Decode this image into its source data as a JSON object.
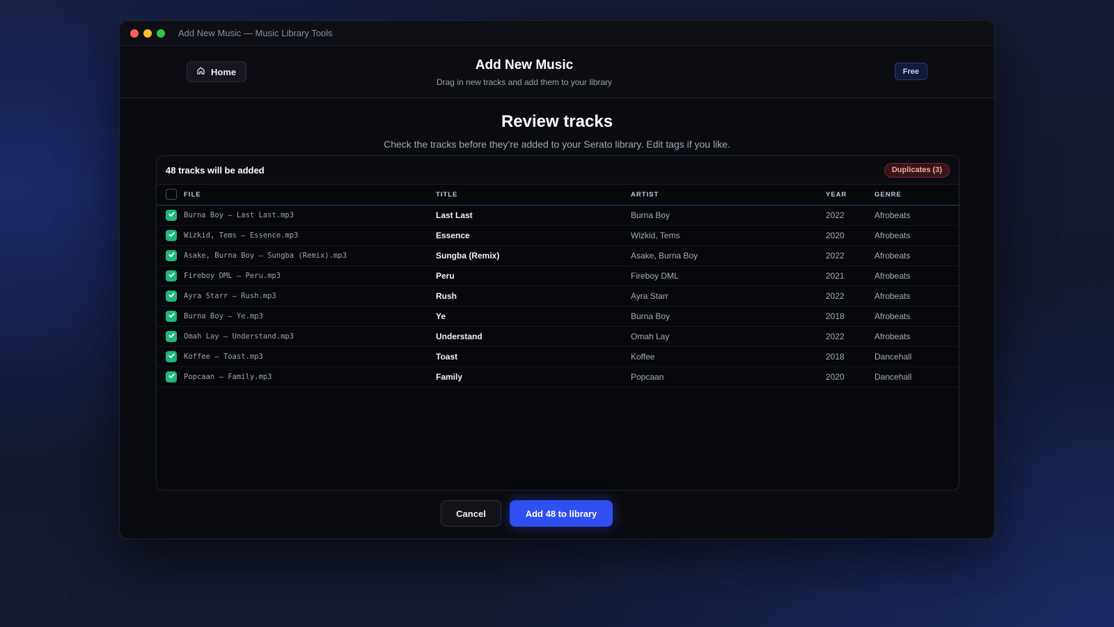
{
  "window": {
    "title": "Add New Music — Music Library Tools"
  },
  "header": {
    "home_label": "Home",
    "title": "Add New Music",
    "subtitle": "Drag in new tracks and add them to your library",
    "plan_badge": "Free"
  },
  "review": {
    "title": "Review tracks",
    "subtitle": "Check the tracks before they’re added to your Serato library. Edit tags if you like."
  },
  "panel": {
    "count_label": "48 tracks will be added",
    "duplicates_label": "Duplicates (3)"
  },
  "table": {
    "select_all_checked": false,
    "columns": [
      "FILE",
      "TITLE",
      "ARTIST",
      "YEAR",
      "GENRE"
    ],
    "rows": [
      {
        "checked": true,
        "file": "Burna Boy – Last Last.mp3",
        "title": "Last Last",
        "artist": "Burna Boy",
        "year": "2022",
        "genre": "Afrobeats"
      },
      {
        "checked": true,
        "file": "Wizkid, Tems – Essence.mp3",
        "title": "Essence",
        "artist": "Wizkid, Tems",
        "year": "2020",
        "genre": "Afrobeats"
      },
      {
        "checked": true,
        "file": "Asake, Burna Boy – Sungba (Remix).mp3",
        "title": "Sungba (Remix)",
        "artist": "Asake, Burna Boy",
        "year": "2022",
        "genre": "Afrobeats"
      },
      {
        "checked": true,
        "file": "Fireboy DML – Peru.mp3",
        "title": "Peru",
        "artist": "Fireboy DML",
        "year": "2021",
        "genre": "Afrobeats"
      },
      {
        "checked": true,
        "file": "Ayra Starr – Rush.mp3",
        "title": "Rush",
        "artist": "Ayra Starr",
        "year": "2022",
        "genre": "Afrobeats"
      },
      {
        "checked": true,
        "file": "Burna Boy – Ye.mp3",
        "title": "Ye",
        "artist": "Burna Boy",
        "year": "2018",
        "genre": "Afrobeats"
      },
      {
        "checked": true,
        "file": "Omah Lay – Understand.mp3",
        "title": "Understand",
        "artist": "Omah Lay",
        "year": "2022",
        "genre": "Afrobeats"
      },
      {
        "checked": true,
        "file": "Koffee – Toast.mp3",
        "title": "Toast",
        "artist": "Koffee",
        "year": "2018",
        "genre": "Dancehall"
      },
      {
        "checked": true,
        "file": "Popcaan – Family.mp3",
        "title": "Family",
        "artist": "Popcaan",
        "year": "2020",
        "genre": "Dancehall"
      }
    ]
  },
  "actions": {
    "cancel_label": "Cancel",
    "add_label": "Add 48 to library"
  },
  "colors": {
    "accent": "#2f4ff0",
    "check_green": "#1fb87a",
    "duplicate_red": "#f3a9a9"
  },
  "icons": {
    "home": "home-icon",
    "check": "checkmark-icon"
  }
}
